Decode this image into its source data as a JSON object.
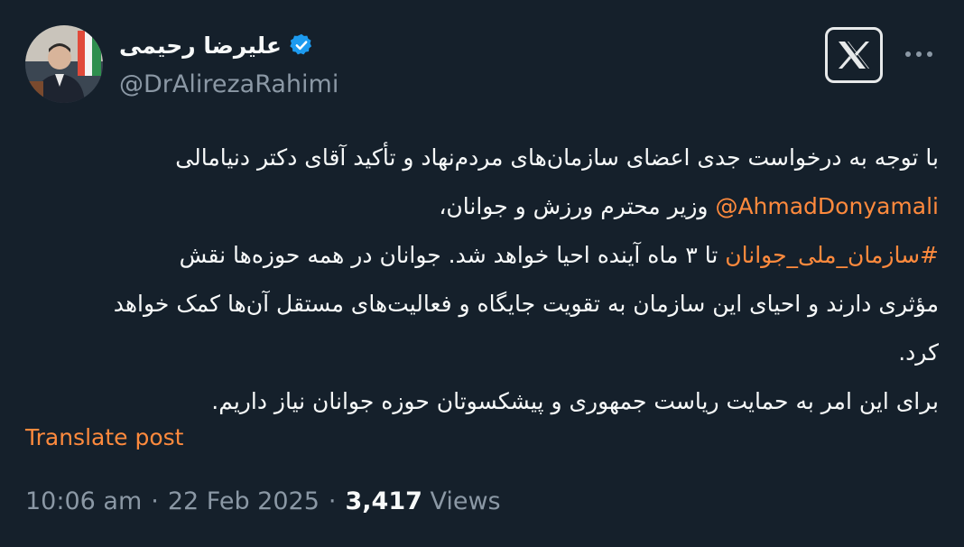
{
  "author": {
    "display_name": "علیرضا رحیمی",
    "handle": "@DrAlirezaRahimi",
    "verified": true
  },
  "tweet": {
    "line1": "با توجه به درخواست جدی اعضای سازمان‌های مردم‌نهاد و تأکید آقای دکتر دنیامالی",
    "line2_mention": "@AhmadDonyamali",
    "line2_text": " وزیر محترم ورزش و جوانان،",
    "line3_hashtag": "#سازمان_ملی_جوانان",
    "line3_text": " تا ۳ ماه آینده احیا خواهد شد. جوانان در همه حوزه‌ها نقش",
    "line4": "مؤثری دارند و احیای این سازمان به تقویت جایگاه و فعالیت‌های مستقل آن‌ها کمک خواهد",
    "line5": "کرد.",
    "line6": "برای این امر به حمایت ریاست جمهوری و پیشکسوتان حوزه جوانان نیاز داریم."
  },
  "translate_label": "Translate post",
  "meta": {
    "time": "10:06 am",
    "separator": "·",
    "date": "22 Feb 2025",
    "views_count": "3,417",
    "views_label": "Views"
  },
  "colors": {
    "background": "#15202b",
    "text": "#f7f9f9",
    "secondary": "#8b98a5",
    "link": "#ff8a3d",
    "verified": "#1d9bf0"
  },
  "icons": {
    "verified": "verified-badge-icon",
    "logo": "x-logo-icon",
    "more": "more-dots-icon"
  }
}
